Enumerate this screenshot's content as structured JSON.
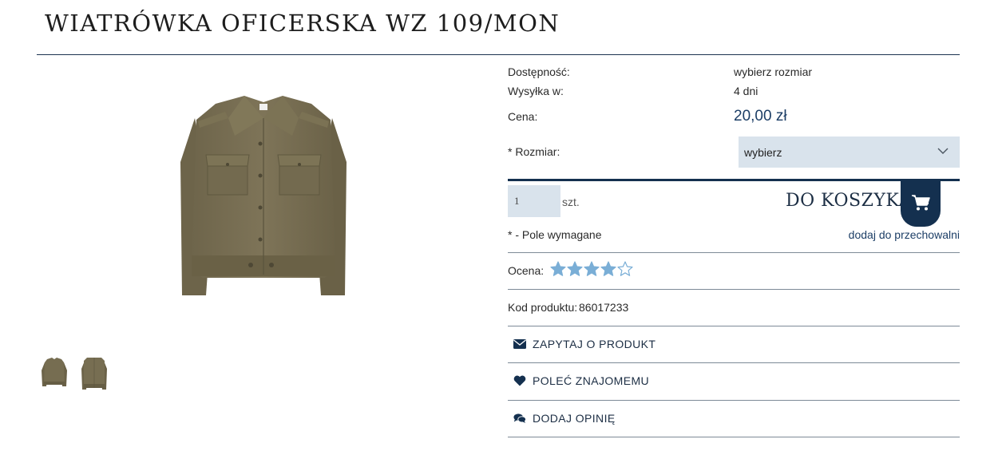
{
  "product": {
    "title": "WIATRÓWKA OFICERSKA WZ 109/MON"
  },
  "details": {
    "availability_label": "Dostępność:",
    "availability_value": "wybierz rozmiar",
    "shipping_label": "Wysyłka w:",
    "shipping_value": "4 dni",
    "price_label": "Cena:",
    "price_value": "20,00 zł",
    "size_label": "* Rozmiar:",
    "size_selected": "wybierz"
  },
  "cart": {
    "quantity": "1",
    "unit": "szt.",
    "add_label": "DO KOSZYKA",
    "required_note": "* - Pole wymagane",
    "storage_link": "dodaj do przechowalni"
  },
  "rating": {
    "label": "Ocena:",
    "value": 4,
    "max": 5
  },
  "code": {
    "label": "Kod produktu:",
    "value": "86017233"
  },
  "actions": [
    {
      "label": "ZAPYTAJ O PRODUKT",
      "icon": "envelope-icon"
    },
    {
      "label": "POLEĆ ZNAJOMEMU",
      "icon": "heart-icon"
    },
    {
      "label": "DODAJ OPINIĘ",
      "icon": "comments-icon"
    }
  ],
  "colors": {
    "navy": "#14304f",
    "field_bg": "#d9e3ec",
    "star": "#7aaed6"
  }
}
